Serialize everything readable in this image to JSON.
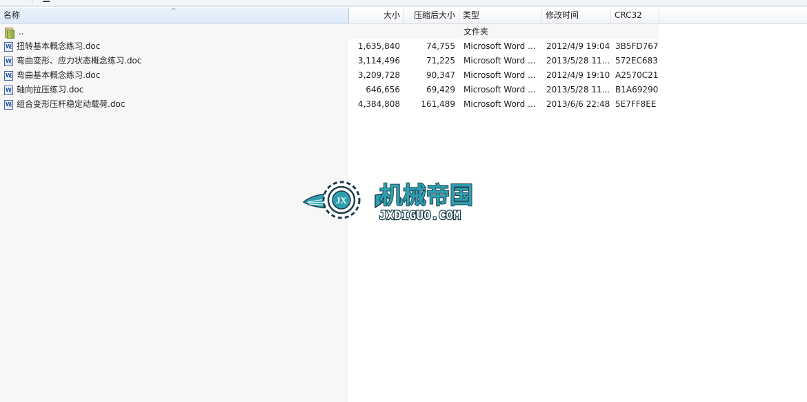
{
  "columns": {
    "name": "名称",
    "size": "大小",
    "packed": "压缩后大小",
    "type": "类型",
    "modified": "修改时间",
    "crc": "CRC32"
  },
  "sort_indicator": "^",
  "parent_row": {
    "name": "..",
    "type": "文件夹"
  },
  "files": [
    {
      "name": "扭转基本概念练习.doc",
      "size": "1,635,840",
      "packed": "74,755",
      "type": "Microsoft Word ...",
      "modified": "2012/4/9 19:04",
      "crc": "3B5FD767"
    },
    {
      "name": "弯曲变形、应力状态概念练习.doc",
      "size": "3,114,496",
      "packed": "71,225",
      "type": "Microsoft Word ...",
      "modified": "2013/5/28 11...",
      "crc": "572EC683"
    },
    {
      "name": "弯曲基本概念练习.doc",
      "size": "3,209,728",
      "packed": "90,347",
      "type": "Microsoft Word ...",
      "modified": "2012/4/9 19:10",
      "crc": "A2570C21"
    },
    {
      "name": "轴向拉压练习.doc",
      "size": "646,656",
      "packed": "69,429",
      "type": "Microsoft Word ...",
      "modified": "2013/5/28 11...",
      "crc": "B1A69290"
    },
    {
      "name": "组合变形压杆稳定动载荷.doc",
      "size": "4,384,808",
      "packed": "161,489",
      "type": "Microsoft Word ...",
      "modified": "2013/6/6 22:48",
      "crc": "5E7FF8EE"
    }
  ],
  "watermark": {
    "cn_text": "机械帝国",
    "url_text": "JXDIGUO.COM",
    "emblem_text": "JX"
  },
  "colors": {
    "watermark_teal": "#2e9fb0",
    "watermark_dark": "#1a3d4a",
    "header_selected": "#dbe9f8"
  }
}
